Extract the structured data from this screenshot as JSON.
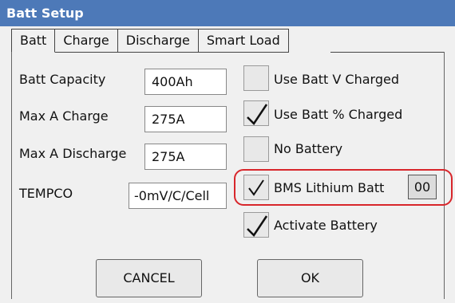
{
  "window": {
    "title": "Batt Setup"
  },
  "tabs": [
    {
      "label": "Batt"
    },
    {
      "label": "Charge"
    },
    {
      "label": "Discharge"
    },
    {
      "label": "Smart Load"
    }
  ],
  "fields": {
    "batt_capacity": {
      "label": "Batt Capacity",
      "value": "400Ah"
    },
    "max_a_charge": {
      "label": "Max A Charge",
      "value": "275A"
    },
    "max_a_discharge": {
      "label": "Max A Discharge",
      "value": "275A"
    },
    "tempco": {
      "label": "TEMPCO",
      "value": "-0mV/C/Cell"
    }
  },
  "options": {
    "use_batt_v_charged": {
      "label": "Use Batt V Charged",
      "checked": false
    },
    "use_batt_pct_charged": {
      "label": "Use Batt % Charged",
      "checked": true
    },
    "no_battery": {
      "label": "No Battery",
      "checked": false
    },
    "bms_lithium_batt": {
      "label": "BMS Lithium Batt",
      "checked": true,
      "value": "00"
    },
    "activate_battery": {
      "label": "Activate Battery",
      "checked": true
    }
  },
  "buttons": {
    "cancel": "CANCEL",
    "ok": "OK"
  },
  "colors": {
    "titlebar": "#4d79b8",
    "highlight": "#d8262b"
  }
}
